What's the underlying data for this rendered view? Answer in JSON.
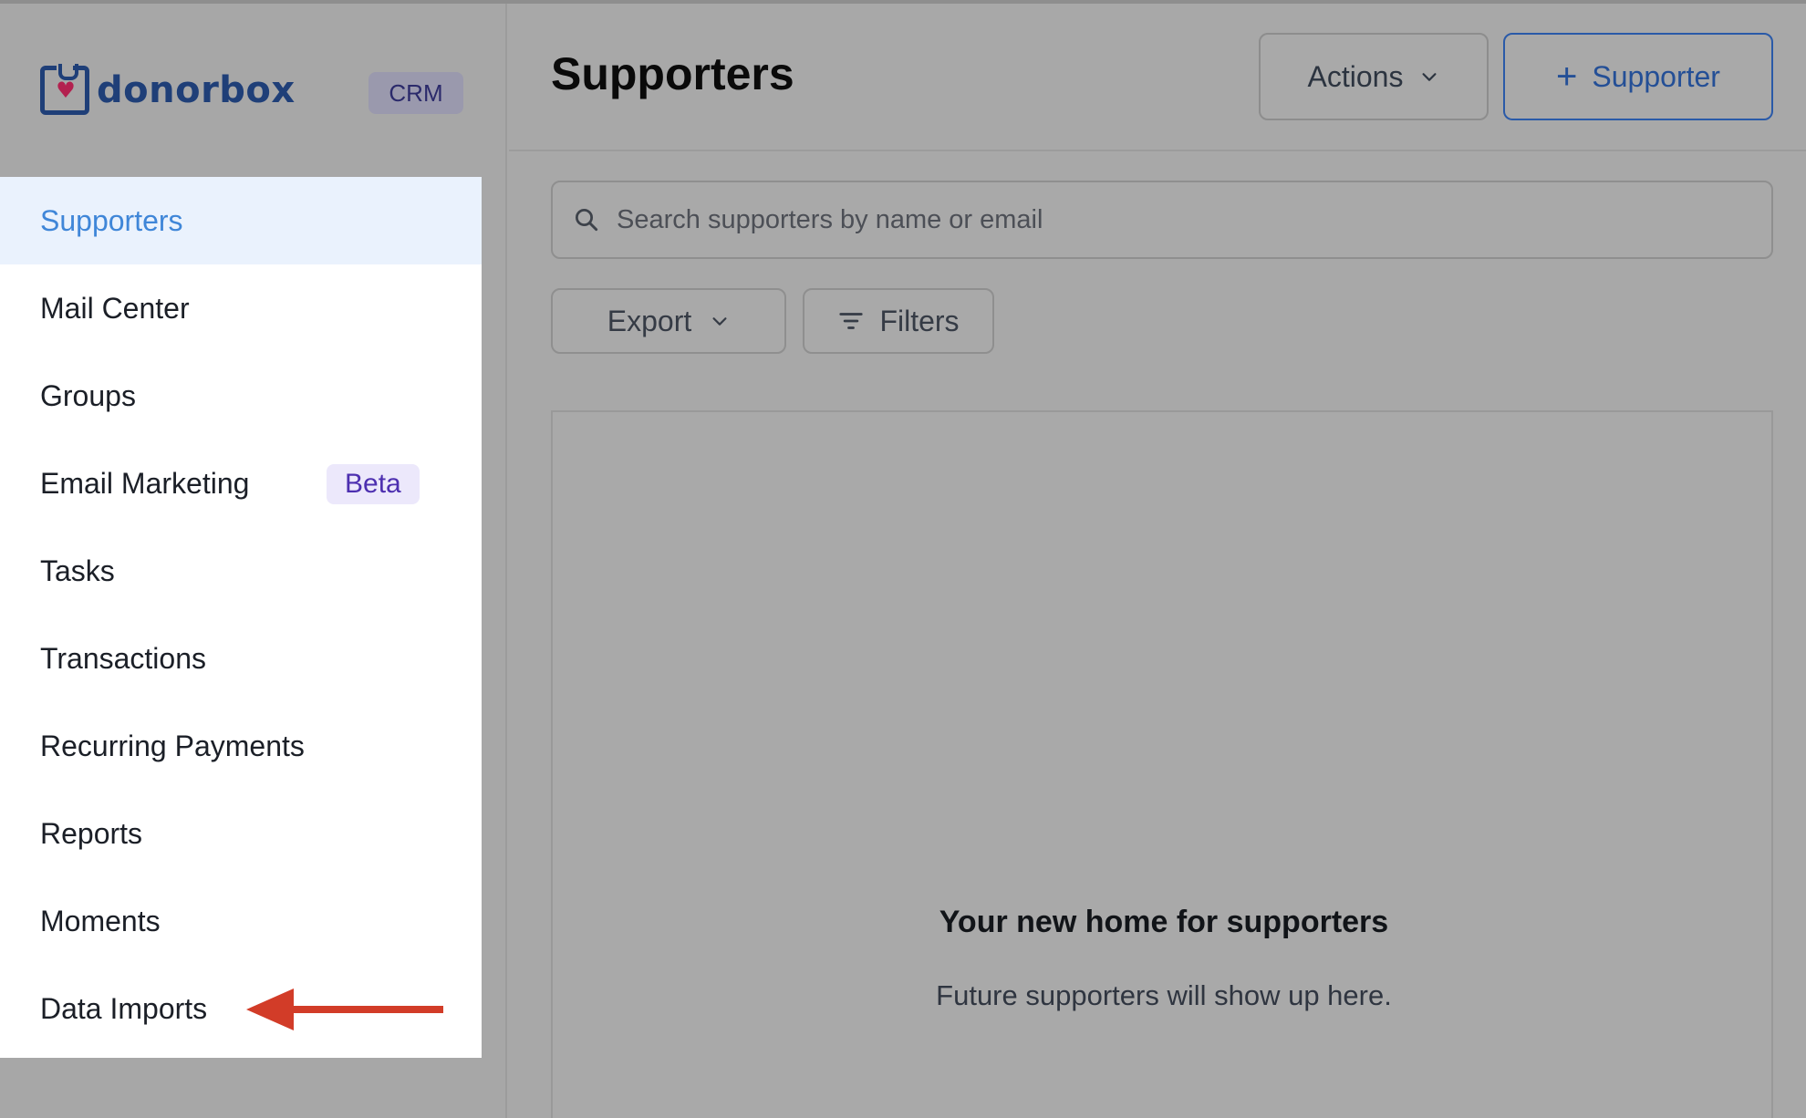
{
  "brand": {
    "logo_text": "donorbox",
    "app_badge": "CRM"
  },
  "sidebar": {
    "items": [
      {
        "label": "Supporters",
        "active": true
      },
      {
        "label": "Mail Center"
      },
      {
        "label": "Groups"
      },
      {
        "label": "Email Marketing",
        "badge": "Beta"
      },
      {
        "label": "Tasks"
      },
      {
        "label": "Transactions"
      },
      {
        "label": "Recurring Payments"
      },
      {
        "label": "Reports"
      },
      {
        "label": "Moments"
      },
      {
        "label": "Data Imports",
        "annotated": true
      }
    ]
  },
  "header": {
    "title": "Supporters",
    "actions_label": "Actions",
    "add_supporter_label": "Supporter"
  },
  "search": {
    "placeholder": "Search supporters by name or email"
  },
  "toolbar": {
    "export_label": "Export",
    "filters_label": "Filters"
  },
  "empty_state": {
    "title": "Your new home for supporters",
    "subtitle": "Future supporters will show up here."
  },
  "colors": {
    "accent": "#3f86d8",
    "brand_navy": "#1f3f78",
    "brand_heart": "#b3214f",
    "beta_text": "#4d2fb0",
    "annotation_arrow": "#d23c28",
    "overlay_gray": "#a8a8a8"
  },
  "icons": {
    "search": "search-icon",
    "chevron": "chevron-down-icon",
    "filter": "filter-icon",
    "plus": "plus-icon",
    "arrow": "arrow-left-icon"
  }
}
